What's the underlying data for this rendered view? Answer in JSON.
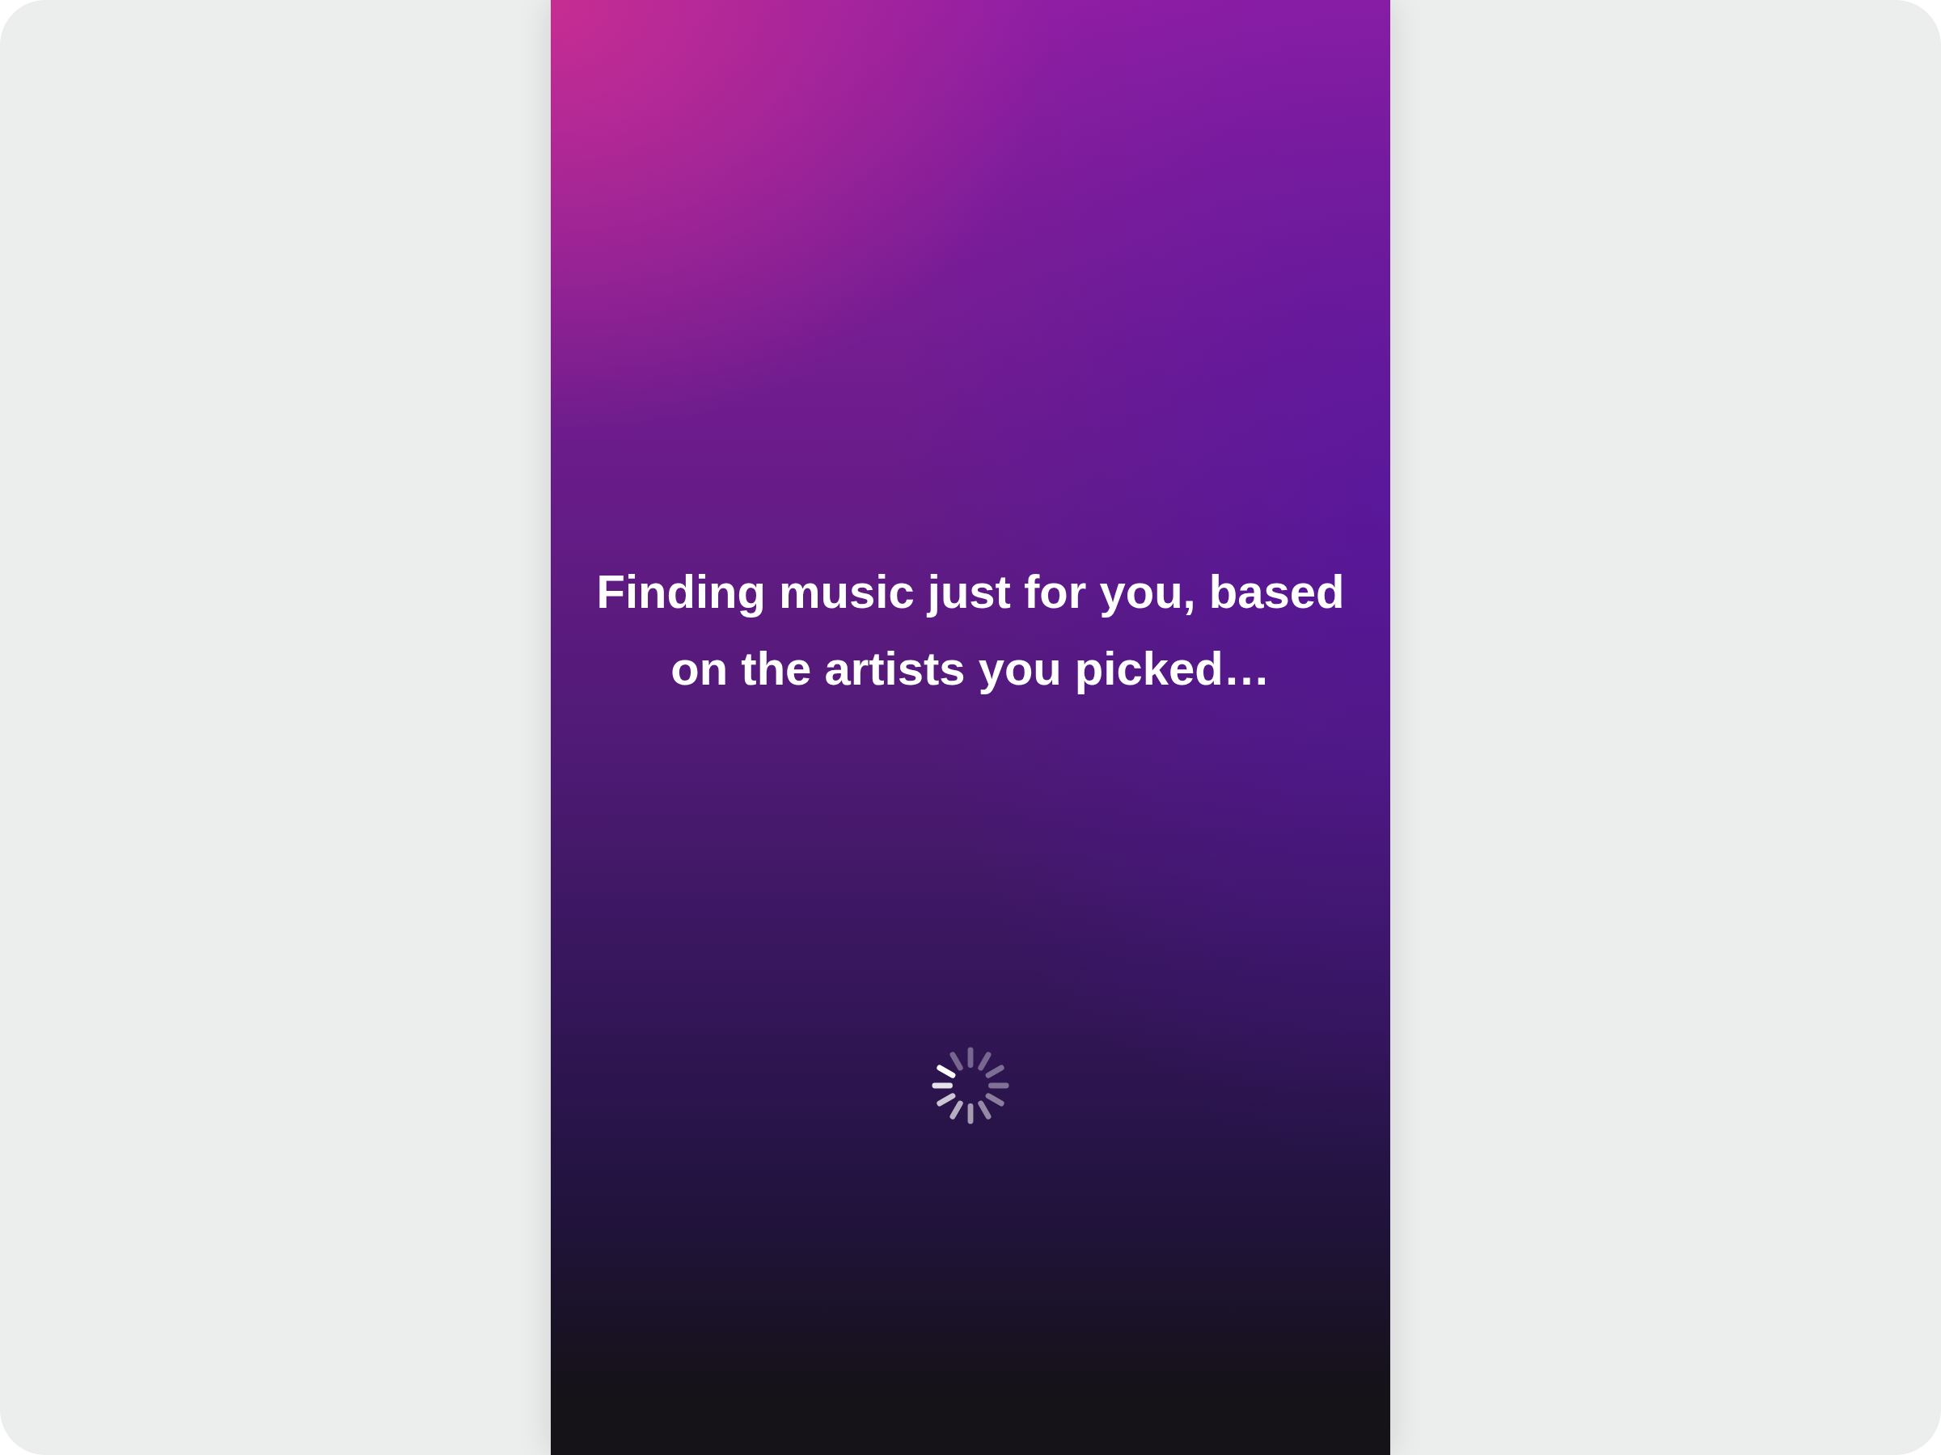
{
  "screen": {
    "message": "Finding music just for you, based on the artists you picked…",
    "loading": true
  }
}
